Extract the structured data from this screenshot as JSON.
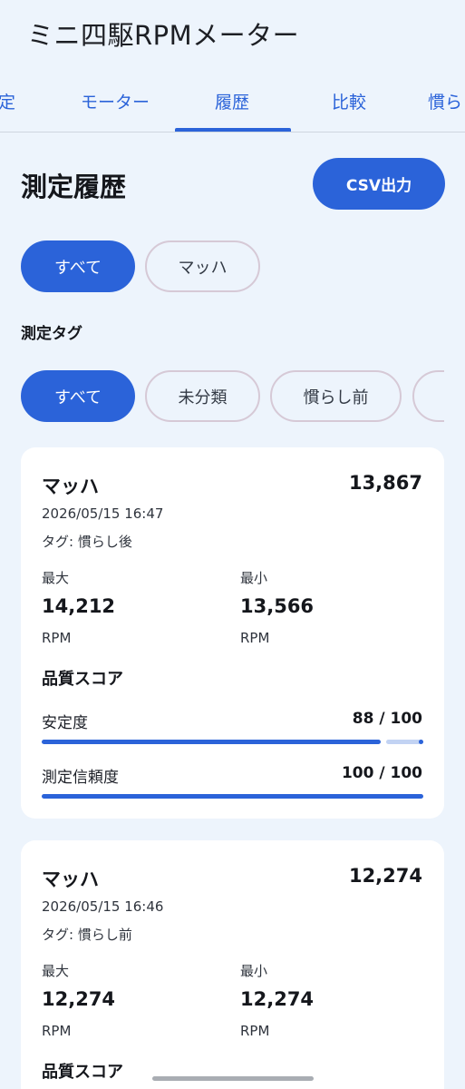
{
  "app": {
    "title": "ミニ四駆RPMメーター"
  },
  "tabs": [
    {
      "label": "定"
    },
    {
      "label": "モーター"
    },
    {
      "label": "履歴",
      "active": true
    },
    {
      "label": "比較"
    },
    {
      "label": "慣ら"
    }
  ],
  "history": {
    "heading": "測定履歴",
    "csv_label": "CSV出力",
    "motor_filters": [
      {
        "label": "すべて",
        "selected": true
      },
      {
        "label": "マッハ",
        "selected": false
      }
    ],
    "tag_heading": "測定タグ",
    "tag_filters": [
      {
        "label": "すべて",
        "selected": true
      },
      {
        "label": "未分類",
        "selected": false
      },
      {
        "label": "慣らし前",
        "selected": false
      },
      {
        "label": "",
        "selected": false
      }
    ]
  },
  "records": [
    {
      "name": "マッハ",
      "rpm": "13,867",
      "datetime": "2026/05/15 16:47",
      "tag": "タグ: 慣らし後",
      "max_label": "最大",
      "max_value": "14,212",
      "max_unit": "RPM",
      "min_label": "最小",
      "min_value": "13,566",
      "min_unit": "RPM",
      "quality_heading": "品質スコア",
      "stability_label": "安定度",
      "stability_value": "88 / 100",
      "stability": 88,
      "confidence_label": "測定信頼度",
      "confidence_value": "100 / 100",
      "confidence": 100
    },
    {
      "name": "マッハ",
      "rpm": "12,274",
      "datetime": "2026/05/15 16:46",
      "tag": "タグ: 慣らし前",
      "max_label": "最大",
      "max_value": "12,274",
      "max_unit": "RPM",
      "min_label": "最小",
      "min_value": "12,274",
      "min_unit": "RPM",
      "quality_heading": "品質スコア"
    }
  ],
  "colors": {
    "accent": "#2b63d9",
    "background": "#edf4fc",
    "card": "#ffffff",
    "track": "#c2d3f3"
  }
}
